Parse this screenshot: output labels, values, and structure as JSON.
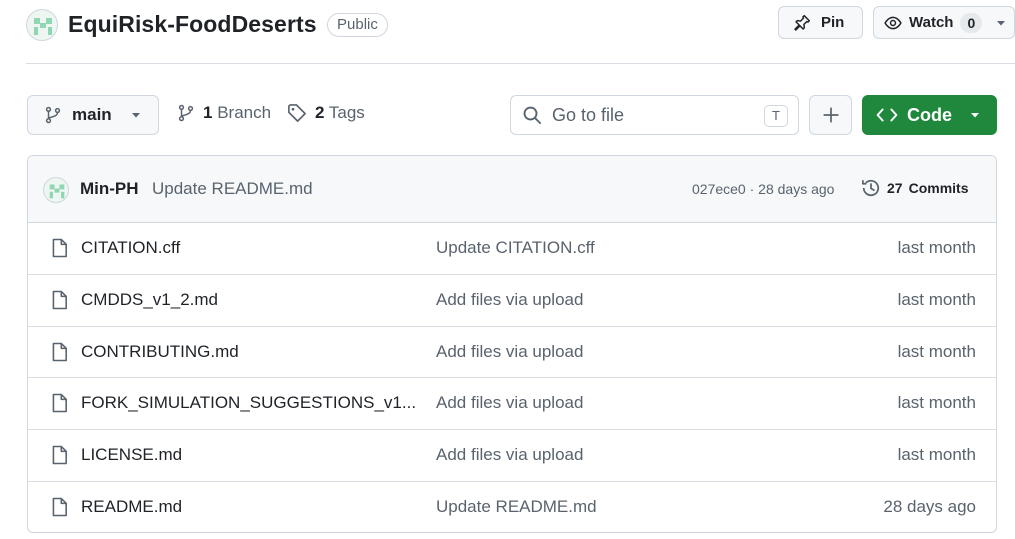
{
  "repo": {
    "name": "EquiRisk-FoodDeserts",
    "visibility": "Public",
    "pin_label": "Pin",
    "watch_label": "Watch",
    "watch_count": "0"
  },
  "toolbar": {
    "branch": "main",
    "branch_count": "1",
    "branch_label": "Branch",
    "tag_count": "2",
    "tag_label": "Tags",
    "goto_placeholder": "Go to file",
    "goto_shortcut": "T",
    "code_label": "Code"
  },
  "commit": {
    "author": "Min-PH",
    "message": "Update README.md",
    "meta": "027ece0 · 28 days ago",
    "commits_count": "27",
    "commits_label": "Commits"
  },
  "files": [
    {
      "name": "CITATION.cff",
      "commit": "Update CITATION.cff",
      "time": "last month"
    },
    {
      "name": "CMDDS_v1_2.md",
      "commit": "Add files via upload",
      "time": "last month"
    },
    {
      "name": "CONTRIBUTING.md",
      "commit": "Add files via upload",
      "time": "last month"
    },
    {
      "name": "FORK_SIMULATION_SUGGESTIONS_v1...",
      "commit": "Add files via upload",
      "time": "last month"
    },
    {
      "name": "LICENSE.md",
      "commit": "Add files via upload",
      "time": "last month"
    },
    {
      "name": "README.md",
      "commit": "Update README.md",
      "time": "28 days ago"
    }
  ],
  "colors": {
    "primary_button": "#1f883d",
    "border": "#d0d7de",
    "muted_text": "#59636e",
    "avatar_green": "#8fd6b3"
  }
}
